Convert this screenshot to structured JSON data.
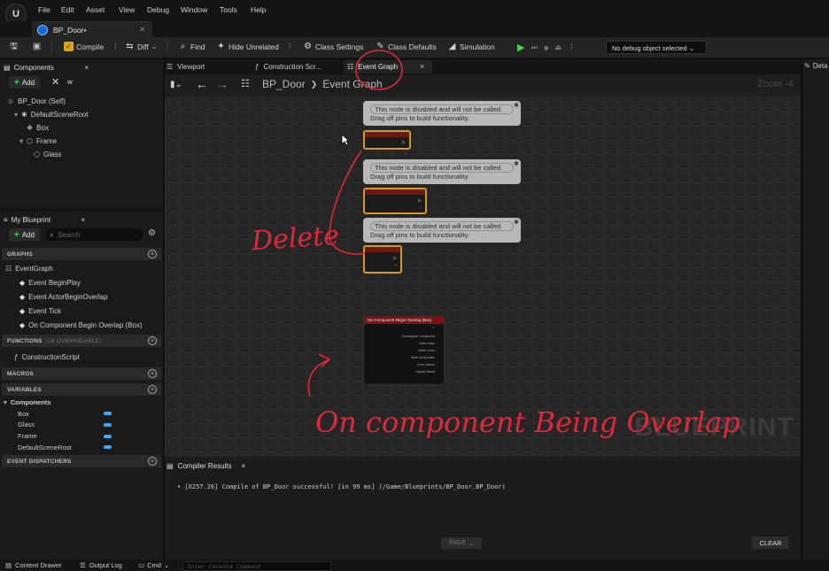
{
  "menu": {
    "logo": "U",
    "items": [
      "File",
      "Edit",
      "Asset",
      "View",
      "Debug",
      "Window",
      "Tools",
      "Help"
    ]
  },
  "document_tab": {
    "label": "BP_Door•",
    "close": "×"
  },
  "toolbar": {
    "compile": "Compile",
    "diff": "Diff",
    "find": "Find",
    "hide_unrelated": "Hide Unrelated",
    "class_settings": "Class Settings",
    "class_defaults": "Class Defaults",
    "simulation": "Simulation",
    "debug_object": "No debug object selected"
  },
  "components_panel": {
    "title": "Components",
    "add_label": "Add",
    "search_value": "w",
    "tree": [
      {
        "label": "BP_Door (Self)",
        "icon": "person-icon",
        "indent": 0
      },
      {
        "label": "DefaultSceneRoot",
        "icon": "scene-root-icon",
        "indent": 1
      },
      {
        "label": "Box",
        "icon": "box-collision-icon",
        "indent": 2
      },
      {
        "label": "Frame",
        "icon": "static-mesh-icon",
        "indent": 2
      },
      {
        "label": "Glass",
        "icon": "static-mesh-icon",
        "indent": 3
      }
    ]
  },
  "my_blueprint": {
    "title": "My Blueprint",
    "add_label": "Add",
    "search_placeholder": "Search",
    "graphs_header": "GRAPHS",
    "event_graph": "EventGraph",
    "events": [
      "Event BeginPlay",
      "Event ActorBeginOverlap",
      "Event Tick",
      "On Component Begin Overlap (Box)"
    ],
    "functions_header": "FUNCTIONS",
    "functions_note": "(19 OVERRIDABLE)",
    "functions": [
      "ConstructionScript"
    ],
    "macros_header": "MACROS",
    "variables_header": "VARIABLES",
    "components_group": "Components",
    "variables": [
      "Box",
      "Glass",
      "Frame",
      "DefaultSceneRoot"
    ],
    "dispatchers_header": "EVENT DISPATCHERS"
  },
  "editor_tabs": [
    {
      "label": "Viewport",
      "icon": "viewport-icon"
    },
    {
      "label": "Construction Scr...",
      "icon": "function-icon"
    },
    {
      "label": "Event Graph",
      "icon": "graph-icon",
      "active": true
    }
  ],
  "details_tab": "Deta",
  "breadcrumb": {
    "blueprint": "BP_Door",
    "separator": "❯",
    "graph": "Event Graph"
  },
  "zoom": "Zoom -4",
  "graph": {
    "disabled_comment_line1": "This node is disabled and will not be called.",
    "disabled_comment_line2": "Drag off pins to build functionality.",
    "overlap_node_title": "On Component Begin Overlap (Box)",
    "overlap_pins": [
      "Overlapped Component",
      "Other Actor",
      "Other Comp",
      "Other Body Index",
      "From Sweep",
      "Sweep Result"
    ],
    "watermark": "BLUEPRINT"
  },
  "annotations": {
    "delete": "Delete",
    "overlap": "On component Being Overlap"
  },
  "compiler_results": {
    "title": "Compiler Results",
    "message": "•  [0257.26] Compile of BP_Door successful! [in 99 ms] (/Game/Blueprints/BP_Door.BP_Door)",
    "page_label": "PAGE",
    "clear_label": "CLEAR"
  },
  "bottom_bar": {
    "content_drawer": "Content Drawer",
    "output_log": "Output Log",
    "cmd": "Cmd",
    "console_placeholder": "Enter Console Command"
  },
  "colors": {
    "accent_blue": "#3fa7ff",
    "event_border": "#d39a2a",
    "annotation_red": "#e0283a"
  }
}
